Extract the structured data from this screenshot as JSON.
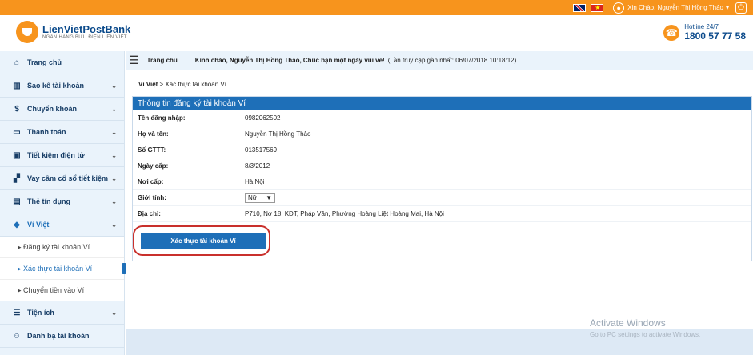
{
  "topbar": {
    "greeting": "Xin Chào, Nguyễn Thị Hồng Thảo",
    "greeting_caret": "▾"
  },
  "header": {
    "brand": "LienVietPostBank",
    "brand_sub": "NGÂN HÀNG BƯU ĐIỆN LIÊN VIỆT",
    "hotline_label": "Hotline 24/7",
    "hotline_number": "1800 57 77 58"
  },
  "sidebar": [
    {
      "label": "Trang chủ",
      "icon": "home-icon"
    },
    {
      "label": "Sao kê tài khoản",
      "icon": "bank-icon"
    },
    {
      "label": "Chuyển khoản",
      "icon": "dollar-icon"
    },
    {
      "label": "Thanh toán",
      "icon": "card-icon"
    },
    {
      "label": "Tiết kiệm điện tử",
      "icon": "savings-icon"
    },
    {
      "label": "Vay cầm cố sổ tiết kiệm",
      "icon": "loan-icon"
    },
    {
      "label": "Thẻ tín dụng",
      "icon": "credit-card-icon"
    },
    {
      "label": "Ví Việt",
      "icon": "wallet-icon"
    },
    {
      "label": "Tiện ích",
      "icon": "list-icon"
    },
    {
      "label": "Danh bạ tài khoản",
      "icon": "contacts-icon"
    }
  ],
  "submenu": [
    "Đăng ký tài khoản Ví",
    "Xác thực tài khoản Ví",
    "Chuyển tiền vào Ví"
  ],
  "crumbbar": {
    "home": "Trang chủ",
    "welcome": "Kính chào, Nguyễn Thị Hồng Thảo, Chúc bạn một ngày vui vẻ!",
    "last_access": "(Lần truy cập gần nhất: 06/07/2018 10:18:12)"
  },
  "page_breadcrumb": {
    "root": "Ví Việt",
    "current": " > Xác thực tài khoản Ví"
  },
  "panel": {
    "title": "Thông tin đăng ký tài khoản Ví",
    "rows": [
      {
        "label": "Tên đăng nhập:",
        "value": "0982062502"
      },
      {
        "label": "Họ và tên:",
        "value": "Nguyễn Thị Hồng Thảo"
      },
      {
        "label": "Số GTTT:",
        "value": "013517569"
      },
      {
        "label": "Ngày cấp:",
        "value": "8/3/2012"
      },
      {
        "label": "Nơi cấp:",
        "value": "Hà Nội"
      },
      {
        "label": "Giới tính:",
        "value": "Nữ"
      },
      {
        "label": "Địa chỉ:",
        "value": "P710, Nơ 18, KĐT, Pháp Vân, Phường Hoàng Liệt Hoàng Mai, Hà Nội"
      }
    ],
    "button": "Xác thực tài khoản Ví"
  },
  "watermark": {
    "title": "Activate Windows",
    "sub": "Go to PC settings to activate Windows."
  }
}
